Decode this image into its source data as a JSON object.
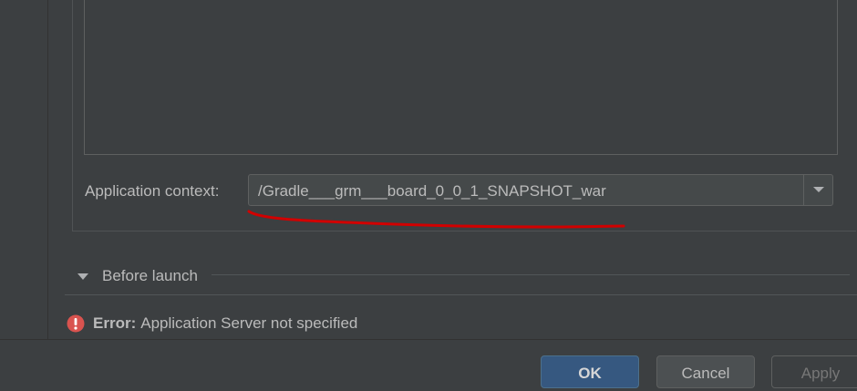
{
  "run_config": {
    "application_context_label": "Application context:",
    "application_context_value": "/Gradle___grm___board_0_0_1_SNAPSHOT_war",
    "before_launch_label": "Before launch"
  },
  "error": {
    "prefix": "Error:",
    "message": "Application Server not specified"
  },
  "buttons": {
    "ok": "OK",
    "cancel": "Cancel",
    "apply": "Apply"
  },
  "colors": {
    "background": "#3c3f41",
    "annotation": "#d10000",
    "error_icon": "#d9534f",
    "ok_button": "#365880"
  }
}
